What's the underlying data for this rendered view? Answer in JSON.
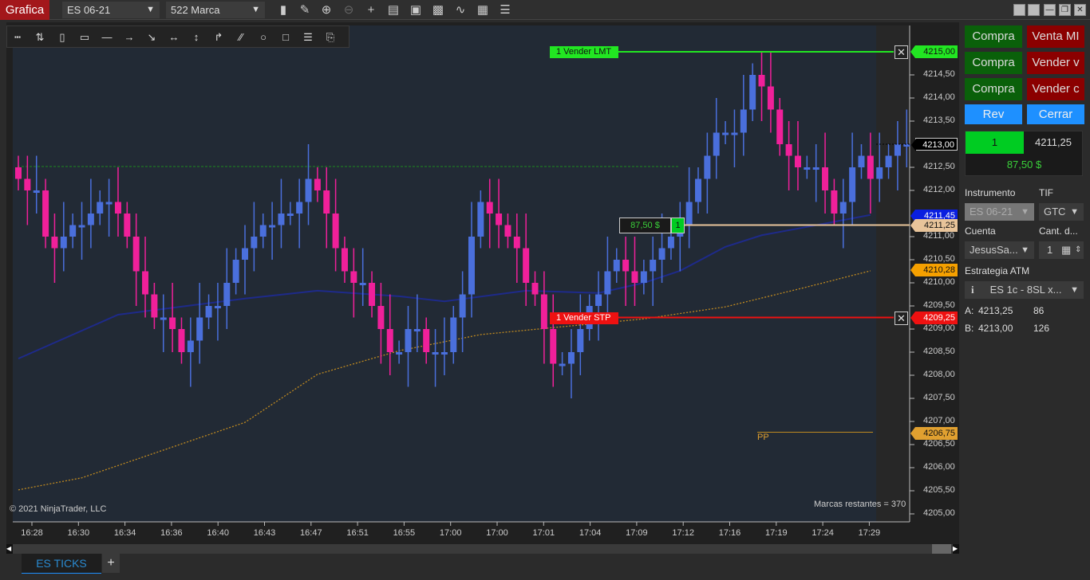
{
  "window": {
    "title": "Grafica",
    "instrument": "ES 06-21",
    "bar_type": "522 Marca"
  },
  "toolbar_icons": [
    "bar-chart-icon",
    "pencil-icon",
    "zoom-in-icon",
    "zoom-out-icon",
    "crosshair-icon",
    "data-box-icon",
    "chart-trader-icon",
    "indicators-icon",
    "strategies-icon",
    "templates-icon",
    "properties-icon"
  ],
  "drawing_tools": [
    "ruler-icon",
    "risk-reward-icon",
    "region-highlight-y-icon",
    "region-highlight-x-icon",
    "line-icon",
    "ray-icon",
    "arrow-line-icon",
    "extended-line-icon",
    "vertical-line-icon",
    "angled-line-icon",
    "parallel-lines-icon",
    "ellipse-icon",
    "rectangle-icon",
    "fibonacci-icon",
    "text-icon"
  ],
  "chart": {
    "copyright": "© 2021 NinjaTrader, LLC",
    "bars_remaining": "Marcas restantes = 370",
    "pivot_label": "PP",
    "colors": {
      "up": "#4a6fdc",
      "down": "#f0209a",
      "bg": "#222a35",
      "ma_fast": "#1e2a8a",
      "ma_slow": "#c08a20"
    },
    "closes": [
      4212.25,
      4212.0,
      4212.0,
      4211.0,
      4210.75,
      4211.0,
      4211.25,
      4211.25,
      4211.5,
      4211.75,
      4211.75,
      4211.5,
      4211.0,
      4210.25,
      4209.75,
      4209.25,
      4209.25,
      4209.0,
      4208.5,
      4208.75,
      4209.25,
      4209.5,
      4209.5,
      4210.0,
      4210.5,
      4210.75,
      4211.0,
      4211.25,
      4211.25,
      4211.5,
      4211.5,
      4211.75,
      4212.25,
      4212.0,
      4211.5,
      4210.75,
      4210.25,
      4210.0,
      4210.0,
      4209.5,
      4209.0,
      4208.5,
      4208.5,
      4209.0,
      4209.0,
      4208.5,
      4208.5,
      4208.5,
      4209.25,
      4209.75,
      4211.0,
      4211.75,
      4211.5,
      4211.25,
      4211.0,
      4210.75,
      4210.0,
      4209.75,
      4209.0,
      4208.25,
      4208.25,
      4208.5,
      4209.0,
      4209.5,
      4209.75,
      4210.25,
      4210.5,
      4210.25,
      4210.0,
      4210.25,
      4210.5,
      4210.75,
      4211.0,
      4211.25,
      4211.75,
      4212.25,
      4212.75,
      4213.25,
      4213.25,
      4213.25,
      4213.75,
      4214.5,
      4214.25,
      4213.75,
      4213.0,
      4212.75,
      4212.5,
      4212.5,
      4212.5,
      4212.0,
      4211.5,
      4211.75,
      4212.5,
      4212.75,
      4212.25,
      4212.5,
      4212.75,
      4213.0,
      4213.0
    ],
    "ma_fast": [
      [
        0,
        4208.36
      ],
      [
        11,
        4209.31
      ],
      [
        25,
        4209.66
      ],
      [
        33,
        4209.83
      ],
      [
        42,
        4209.71
      ],
      [
        47,
        4209.6
      ],
      [
        56,
        4209.83
      ],
      [
        64,
        4209.78
      ],
      [
        69,
        4210.0
      ],
      [
        73,
        4210.26
      ],
      [
        78,
        4210.78
      ],
      [
        82,
        4211.03
      ],
      [
        87,
        4211.21
      ],
      [
        94,
        4211.47
      ]
    ],
    "ma_slow": [
      [
        0,
        4205.52
      ],
      [
        7,
        4205.78
      ],
      [
        16,
        4206.38
      ],
      [
        25,
        4206.98
      ],
      [
        33,
        4208.02
      ],
      [
        42,
        4208.53
      ],
      [
        51,
        4208.88
      ],
      [
        60,
        4209.05
      ],
      [
        69,
        4209.22
      ],
      [
        78,
        4209.48
      ],
      [
        87,
        4209.91
      ],
      [
        94,
        4210.26
      ]
    ],
    "price_ticks": [
      "4214,50",
      "4214,00",
      "4213,50",
      "4212,50",
      "4212,00",
      "4211,00",
      "4210,50",
      "4210,00",
      "4209,50",
      "4209,00",
      "4208,50",
      "4208,00",
      "4207,50",
      "4207,00",
      "4206,50",
      "4206,00",
      "4205,50",
      "4205,00"
    ],
    "price_tags": [
      {
        "text": "4215,00",
        "price": 4215.0,
        "color": "#22e622"
      },
      {
        "text": "4213,00",
        "price": 4213.0,
        "color": "#000000"
      },
      {
        "text": "4211,45",
        "price": 4211.45,
        "color": "#0a1ee0"
      },
      {
        "text": "4211,25",
        "price": 4211.25,
        "color": "#e8c49a"
      },
      {
        "text": "4210,28",
        "price": 4210.28,
        "color": "#f5a000"
      },
      {
        "text": "4209,25",
        "price": 4209.25,
        "color": "#ee1111"
      },
      {
        "text": "4206,75",
        "price": 4206.75,
        "color": "#e0a030"
      }
    ],
    "time_labels": [
      "16:28",
      "16:30",
      "16:34",
      "16:36",
      "16:40",
      "16:43",
      "16:47",
      "16:51",
      "16:55",
      "17:00",
      "17:00",
      "17:01",
      "17:04",
      "17:09",
      "17:12",
      "17:16",
      "17:19",
      "17:24",
      "17:29"
    ],
    "orders": {
      "limit": {
        "label": "1  Vender LMT",
        "price": 4215.0,
        "color": "#22e622"
      },
      "stop": {
        "label": "1  Vender STP",
        "price": 4209.25,
        "color": "#ee1111"
      },
      "position": {
        "pnl": "87,50 $",
        "qty": "1",
        "price": 4211.25
      }
    }
  },
  "tabs": [
    {
      "label": "ES TICKS",
      "active": true
    }
  ],
  "add_tab": "+",
  "trader": {
    "buttons": [
      [
        "Compra",
        "Venta MI"
      ],
      [
        "Compra",
        "Vender v"
      ],
      [
        "Compra",
        "Vender c"
      ]
    ],
    "rev": "Rev",
    "close": "Cerrar",
    "position_qty": "1",
    "avg_price": "4211,25",
    "pnl": "87,50 $",
    "instrument_label": "Instrumento",
    "instrument_value": "ES 06-21",
    "tif_label": "TIF",
    "tif_value": "GTC",
    "account_label": "Cuenta",
    "account_value": "JesusSa...",
    "qty_label": "Cant. d...",
    "qty_value": "1",
    "atm_label": "Estrategia ATM",
    "atm_value": "ES 1c - 8SL x...",
    "ask_label": "A:",
    "ask_price": "4213,25",
    "ask_size": "86",
    "bid_label": "B:",
    "bid_price": "4213,00",
    "bid_size": "126"
  }
}
